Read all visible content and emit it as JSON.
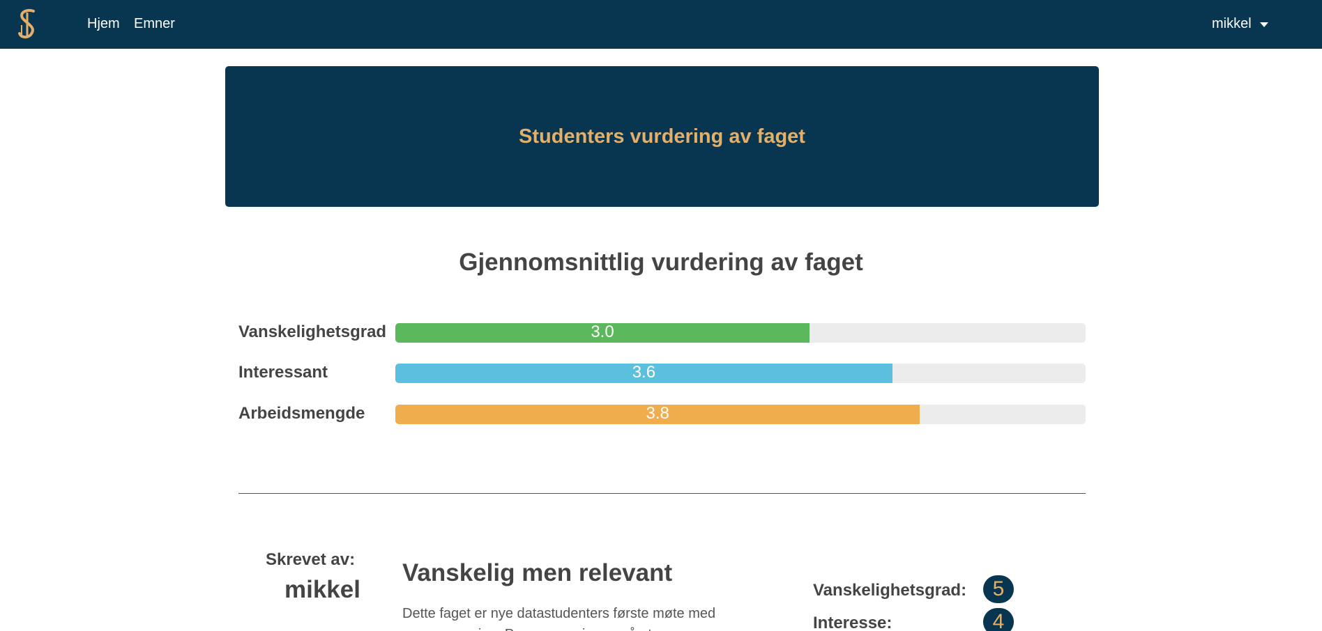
{
  "nav": {
    "logo_icon": "s-monogram-logo-icon",
    "links": [
      "Hjem",
      "Emner"
    ],
    "user": "mikkel"
  },
  "hero": {
    "title": "Studenters vurdering av faget"
  },
  "average": {
    "title": "Gjennomsnittlig vurdering av faget",
    "max_value": 5,
    "ratings": [
      {
        "label": "Vanskelighetsgrad",
        "value": "3.0",
        "fraction": 0.6,
        "color": "#5cb85c"
      },
      {
        "label": "Interessant",
        "value": "3.6",
        "fraction": 0.72,
        "color": "#5bc0de"
      },
      {
        "label": "Arbeidsmengde",
        "value": "3.8",
        "fraction": 0.76,
        "color": "#f0ad4e"
      }
    ]
  },
  "review": {
    "written_by_label": "Skrevet av:",
    "author": "mikkel",
    "title": "Vanskelig men relevant",
    "text": "Dette faget er nye datastudenters første møte med programmering. Programmering er nå et",
    "scores": [
      {
        "label": "Vanskelighetsgrad:",
        "value": "5"
      },
      {
        "label": "Interesse:",
        "value": "4"
      }
    ]
  },
  "colors": {
    "navy": "#08354f",
    "gold": "#e2b06c",
    "track": "#ececed"
  }
}
